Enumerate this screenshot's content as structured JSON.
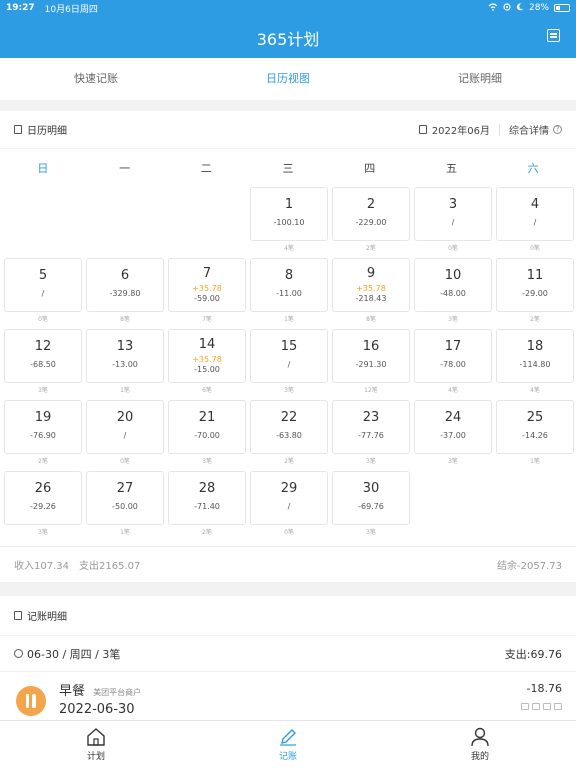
{
  "status_bar": {
    "time": "19:27",
    "date": "10月6日周四",
    "battery": "28%"
  },
  "nav": {
    "title": "365计划",
    "right_icon": "calendar-list-icon"
  },
  "tabs": [
    {
      "label": "快速记账",
      "active": false
    },
    {
      "label": "日历视图",
      "active": true
    },
    {
      "label": "记账明细",
      "active": false
    }
  ],
  "calendar": {
    "section_title": "日历明细",
    "month": "2022年06月",
    "summary_link": "综合详情",
    "weekdays": [
      "日",
      "一",
      "二",
      "三",
      "四",
      "五",
      "六"
    ],
    "leading_blanks": 3,
    "days": [
      {
        "day": "1",
        "income": "",
        "expense": "-100.10",
        "count": "4笔"
      },
      {
        "day": "2",
        "income": "",
        "expense": "-229.00",
        "count": "2笔"
      },
      {
        "day": "3",
        "income": "",
        "expense": "/",
        "count": "0笔"
      },
      {
        "day": "4",
        "income": "",
        "expense": "/",
        "count": "0笔"
      },
      {
        "day": "5",
        "income": "",
        "expense": "/",
        "count": "0笔"
      },
      {
        "day": "6",
        "income": "",
        "expense": "-329.80",
        "count": "8笔"
      },
      {
        "day": "7",
        "income": "+35.78",
        "expense": "-59.00",
        "count": "7笔"
      },
      {
        "day": "8",
        "income": "",
        "expense": "-11.00",
        "count": "1笔"
      },
      {
        "day": "9",
        "income": "+35.78",
        "expense": "-218.43",
        "count": "8笔"
      },
      {
        "day": "10",
        "income": "",
        "expense": "-48.00",
        "count": "3笔"
      },
      {
        "day": "11",
        "income": "",
        "expense": "-29.00",
        "count": "2笔"
      },
      {
        "day": "12",
        "income": "",
        "expense": "-68.50",
        "count": "3笔"
      },
      {
        "day": "13",
        "income": "",
        "expense": "-13.00",
        "count": "1笔"
      },
      {
        "day": "14",
        "income": "+35.78",
        "expense": "-15.00",
        "count": "6笔"
      },
      {
        "day": "15",
        "income": "",
        "expense": "/",
        "count": "3笔"
      },
      {
        "day": "16",
        "income": "",
        "expense": "-291.30",
        "count": "12笔"
      },
      {
        "day": "17",
        "income": "",
        "expense": "-78.00",
        "count": "4笔"
      },
      {
        "day": "18",
        "income": "",
        "expense": "-114.80",
        "count": "4笔"
      },
      {
        "day": "19",
        "income": "",
        "expense": "-76.90",
        "count": "2笔"
      },
      {
        "day": "20",
        "income": "",
        "expense": "/",
        "count": "0笔"
      },
      {
        "day": "21",
        "income": "",
        "expense": "-70.00",
        "count": "3笔"
      },
      {
        "day": "22",
        "income": "",
        "expense": "-63.80",
        "count": "2笔"
      },
      {
        "day": "23",
        "income": "",
        "expense": "-77.76",
        "count": "3笔"
      },
      {
        "day": "24",
        "income": "",
        "expense": "-37.00",
        "count": "3笔"
      },
      {
        "day": "25",
        "income": "",
        "expense": "-14.26",
        "count": "1笔"
      },
      {
        "day": "26",
        "income": "",
        "expense": "-29.26",
        "count": "3笔"
      },
      {
        "day": "27",
        "income": "",
        "expense": "-50.00",
        "count": "1笔"
      },
      {
        "day": "28",
        "income": "",
        "expense": "-71.40",
        "count": "2笔"
      },
      {
        "day": "29",
        "income": "",
        "expense": "/",
        "count": "0笔"
      },
      {
        "day": "30",
        "income": "",
        "expense": "-69.76",
        "count": "3笔"
      }
    ],
    "footer": {
      "income": "收入107.34",
      "expense": "支出2165.07",
      "balance": "结余-2057.73"
    }
  },
  "detail": {
    "section_title": "记账明细",
    "group": {
      "label": "06-30 / 周四 / 3笔",
      "total": "支出:69.76"
    },
    "records": [
      {
        "title": "早餐",
        "merchant": "美团平台商户",
        "date": "2022-06-30",
        "amount": "-18.76",
        "icon": "utensils-icon"
      }
    ]
  },
  "tabbar": [
    {
      "label": "计划",
      "icon": "home-icon",
      "active": false
    },
    {
      "label": "记账",
      "icon": "pencil-icon",
      "active": true
    },
    {
      "label": "我的",
      "icon": "user-icon",
      "active": false
    }
  ],
  "colors": {
    "primary": "#2e9ce3",
    "income": "#f5a623",
    "food_icon": "#f4a44a"
  }
}
